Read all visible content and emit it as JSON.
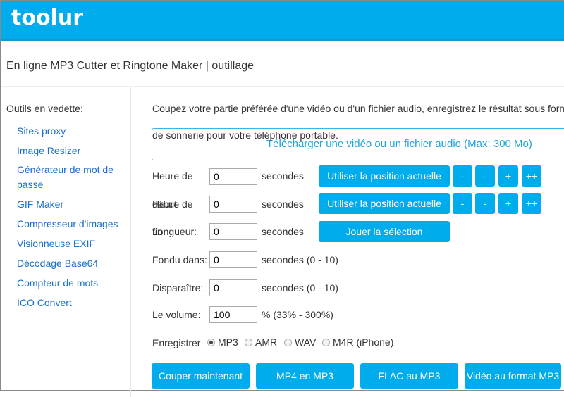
{
  "header": {
    "logo": "toolur",
    "accent": "#00acec"
  },
  "page_title": "En ligne MP3 Cutter et Ringtone Maker | outillage",
  "sidebar": {
    "heading": "Outils en vedette:",
    "items": [
      {
        "label": "Sites proxy"
      },
      {
        "label": "Image Resizer"
      },
      {
        "label": "Générateur de mot de passe"
      },
      {
        "label": "GIF Maker"
      },
      {
        "label": "Compresseur d'images"
      },
      {
        "label": "Visionneuse EXIF"
      },
      {
        "label": "Décodage Base64"
      },
      {
        "label": "Compteur de mots"
      },
      {
        "label": "ICO Convert"
      }
    ]
  },
  "main": {
    "intro_line1": "Coupez votre partie préférée d'une vidéo ou d'un fichier audio, enregistrez le résultat sous forme",
    "intro_line2": "de sonnerie pour votre téléphone portable.",
    "upload_label": "Télécharger une vidéo ou un fichier audio (Max: 300 Mo)",
    "start": {
      "label_a": "Heure de",
      "value": "0",
      "unit": "secondes",
      "button": "Utiliser la position actuelle"
    },
    "end": {
      "label_a": "Heure de",
      "label_b": "début",
      "value": "0",
      "unit": "secondes",
      "button": "Utiliser la position actuelle"
    },
    "length": {
      "label_a": "Longueur:",
      "label_b": "fin",
      "value": "0",
      "unit": "secondes",
      "button": "Jouer la sélection"
    },
    "step_buttons": [
      "-",
      "-",
      "+",
      "++"
    ],
    "fade_in": {
      "label": "Fondu dans:",
      "value": "0",
      "unit": "secondes (0 - 10)"
    },
    "fade_out": {
      "label": "Disparaître:",
      "value": "0",
      "unit": "secondes (0 - 10)"
    },
    "volume": {
      "label": "Le volume:",
      "value": "100",
      "unit": "% (33% - 300%)"
    },
    "save": {
      "label": "Enregistrer",
      "options": [
        "MP3",
        "AMR",
        "WAV",
        "M4R (iPhone)"
      ],
      "selected": "MP3"
    },
    "actions": [
      "Couper maintenant",
      "MP4 en MP3",
      "FLAC au MP3",
      "Vidéo au format MP3"
    ]
  }
}
